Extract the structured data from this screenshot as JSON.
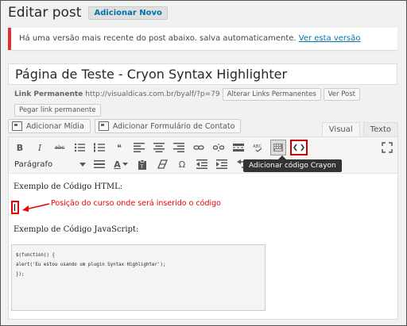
{
  "header": {
    "title": "Editar post",
    "add_new_label": "Adicionar Novo"
  },
  "notice": {
    "text": "Há uma versão mais recente do post abaixo. salva automaticamente. ",
    "link": "Ver esta versão"
  },
  "post": {
    "title": "Página de Teste - Cryon Syntax Highlighter"
  },
  "permalink": {
    "label": "Link Permanente",
    "url": "http://visualdicas.com.br/byalf/?p=79",
    "change_button": "Alterar Links Permanentes",
    "view_button": "Ver Post",
    "get_button": "Pegar link permanente"
  },
  "media": {
    "add_media_label": "Adicionar Mídia",
    "add_form_label": "Adicionar Formulário de Contato"
  },
  "tabs": {
    "visual": "Visual",
    "text": "Texto"
  },
  "toolbar": {
    "bold": "B",
    "italic": "I",
    "strike": "abc",
    "quote": "❝",
    "format_select": "Parágrafo",
    "text_color": "A",
    "omega": "Ω"
  },
  "tooltip": "Adicionar código Crayon",
  "content": {
    "html_heading": "Exemplo de Código HTML:",
    "annotation": "Posição do curso onde será inserido o código",
    "js_heading": "Exemplo de Código JavaScript:",
    "code_lines": [
      "$(function() {",
      "",
      "alert('Eu estou usando um plugin Syntax Highlighter');",
      "",
      "});"
    ]
  },
  "colors": {
    "accent": "#0073aa",
    "highlight": "#cc0000",
    "annotation": "#ee0000"
  }
}
